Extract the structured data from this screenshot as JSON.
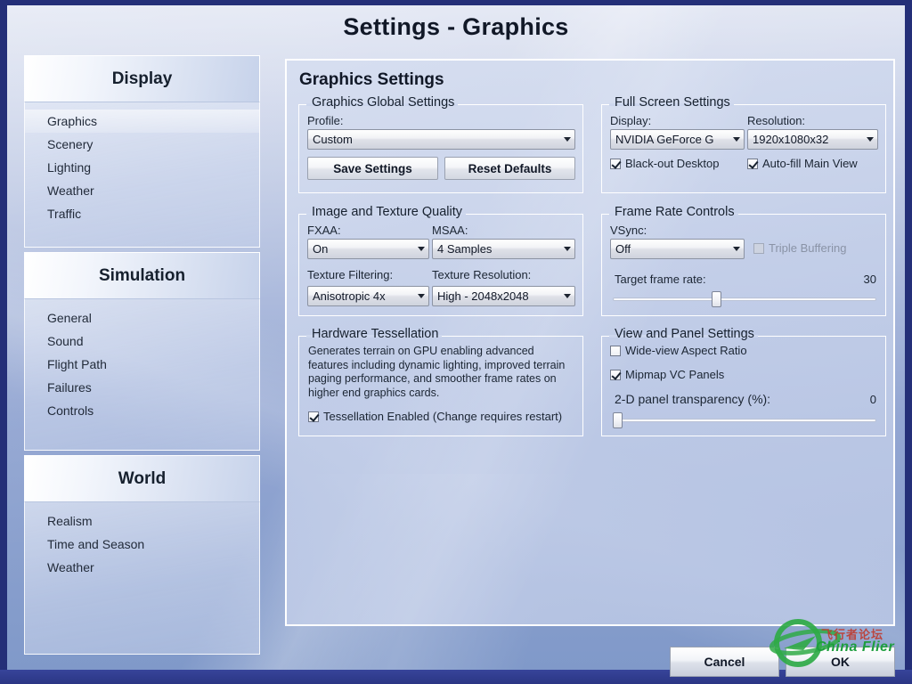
{
  "window": {
    "title": "Settings - Graphics"
  },
  "sidebar": {
    "groups": [
      {
        "header": "Display",
        "items": [
          {
            "label": "Graphics",
            "selected": true
          },
          {
            "label": "Scenery",
            "selected": false
          },
          {
            "label": "Lighting",
            "selected": false
          },
          {
            "label": "Weather",
            "selected": false
          },
          {
            "label": "Traffic",
            "selected": false
          }
        ]
      },
      {
        "header": "Simulation",
        "items": [
          {
            "label": "General",
            "selected": false
          },
          {
            "label": "Sound",
            "selected": false
          },
          {
            "label": "Flight Path",
            "selected": false
          },
          {
            "label": "Failures",
            "selected": false
          },
          {
            "label": "Controls",
            "selected": false
          }
        ]
      },
      {
        "header": "World",
        "items": [
          {
            "label": "Realism",
            "selected": false
          },
          {
            "label": "Time and Season",
            "selected": false
          },
          {
            "label": "Weather",
            "selected": false
          }
        ]
      }
    ]
  },
  "main": {
    "heading": "Graphics Settings",
    "global_settings": {
      "legend": "Graphics Global Settings",
      "profile_label": "Profile:",
      "profile_value": "Custom",
      "save_label": "Save Settings",
      "reset_label": "Reset Defaults"
    },
    "image_texture": {
      "legend": "Image and Texture Quality",
      "fxaa_label": "FXAA:",
      "fxaa_value": "On",
      "msaa_label": "MSAA:",
      "msaa_value": "4 Samples",
      "filtering_label": "Texture Filtering:",
      "filtering_value": "Anisotropic 4x",
      "resolution_label": "Texture Resolution:",
      "resolution_value": "High - 2048x2048"
    },
    "tessellation": {
      "legend": "Hardware Tessellation",
      "description": "Generates terrain on GPU enabling advanced features including dynamic lighting, improved terrain paging performance, and smoother frame rates on higher end graphics cards.",
      "checkbox_label": "Tessellation Enabled (Change requires restart)",
      "checkbox_checked": true
    },
    "full_screen": {
      "legend": "Full Screen Settings",
      "display_label": "Display:",
      "display_value": "NVIDIA GeForce G",
      "resolution_label": "Resolution:",
      "resolution_value": "1920x1080x32",
      "blackout_label": "Black-out Desktop",
      "blackout_checked": true,
      "autofill_label": "Auto-fill Main View",
      "autofill_checked": true
    },
    "frame_rate": {
      "legend": "Frame Rate Controls",
      "vsync_label": "VSync:",
      "vsync_value": "Off",
      "triple_buffering_label": "Triple Buffering",
      "triple_buffering_checked": false,
      "triple_buffering_disabled": true,
      "target_label": "Target frame rate:",
      "target_value": "30",
      "target_percent": 39
    },
    "view_panel": {
      "legend": "View and Panel Settings",
      "wideview_label": "Wide-view Aspect Ratio",
      "wideview_checked": false,
      "mipmap_label": "Mipmap VC Panels",
      "mipmap_checked": true,
      "transparency_label": "2-D panel transparency (%):",
      "transparency_value": "0",
      "transparency_percent": 0
    }
  },
  "footer": {
    "cancel_label": "Cancel",
    "ok_label": "OK"
  },
  "watermark": {
    "chinese_text": "飞行者论坛",
    "english_text": "China Flier",
    "logo_color": "#1e9e3e",
    "cn_color": "#c0392b"
  }
}
